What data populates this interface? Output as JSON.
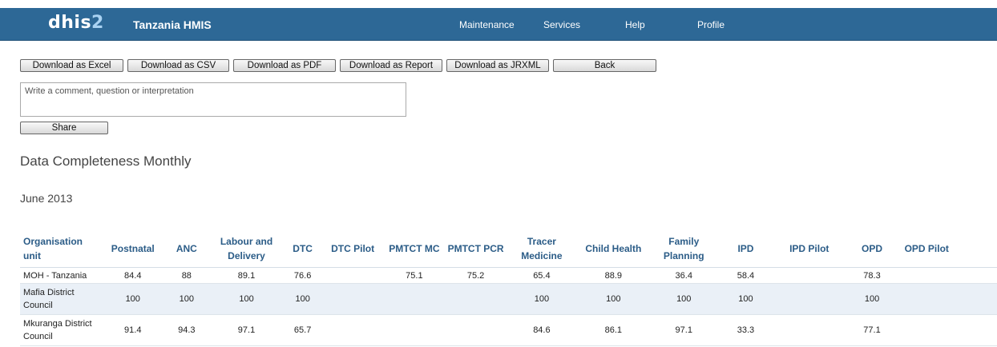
{
  "header": {
    "logo_main": "dhis",
    "logo_digit": "2",
    "app_title": "Tanzania HMIS",
    "menu": [
      "Maintenance",
      "Services",
      "Help",
      "Profile"
    ]
  },
  "toolbar": {
    "excel": "Download as Excel",
    "csv": "Download as CSV",
    "pdf": "Download as PDF",
    "report": "Download as Report",
    "jrxml": "Download as JRXML",
    "back": "Back"
  },
  "comment": {
    "placeholder": "Write a comment, question or interpretation",
    "share": "Share"
  },
  "report": {
    "title": "Data Completeness Monthly",
    "period": "June 2013"
  },
  "table": {
    "columns": [
      "Organisation unit",
      "Postnatal",
      "ANC",
      "Labour and Delivery",
      "DTC",
      "DTC Pilot",
      "PMTCT MC",
      "PMTCT PCR",
      "Tracer Medicine",
      "Child Health",
      "Family Planning",
      "IPD",
      "IPD Pilot",
      "OPD",
      "OPD Pilot"
    ],
    "rows": [
      [
        "MOH - Tanzania",
        "84.4",
        "88",
        "89.1",
        "76.6",
        "",
        "75.1",
        "75.2",
        "65.4",
        "88.9",
        "36.4",
        "58.4",
        "",
        "78.3",
        ""
      ],
      [
        "Mafia District Council",
        "100",
        "100",
        "100",
        "100",
        "",
        "",
        "",
        "100",
        "100",
        "100",
        "100",
        "",
        "100",
        ""
      ],
      [
        "Mkuranga District Council",
        "91.4",
        "94.3",
        "97.1",
        "65.7",
        "",
        "",
        "",
        "84.6",
        "86.1",
        "97.1",
        "33.3",
        "",
        "77.1",
        ""
      ]
    ]
  },
  "colors": {
    "header_bg": "#2d6896",
    "column_header_text": "#2b5c87",
    "alt_row_bg": "#eaf0f7"
  }
}
